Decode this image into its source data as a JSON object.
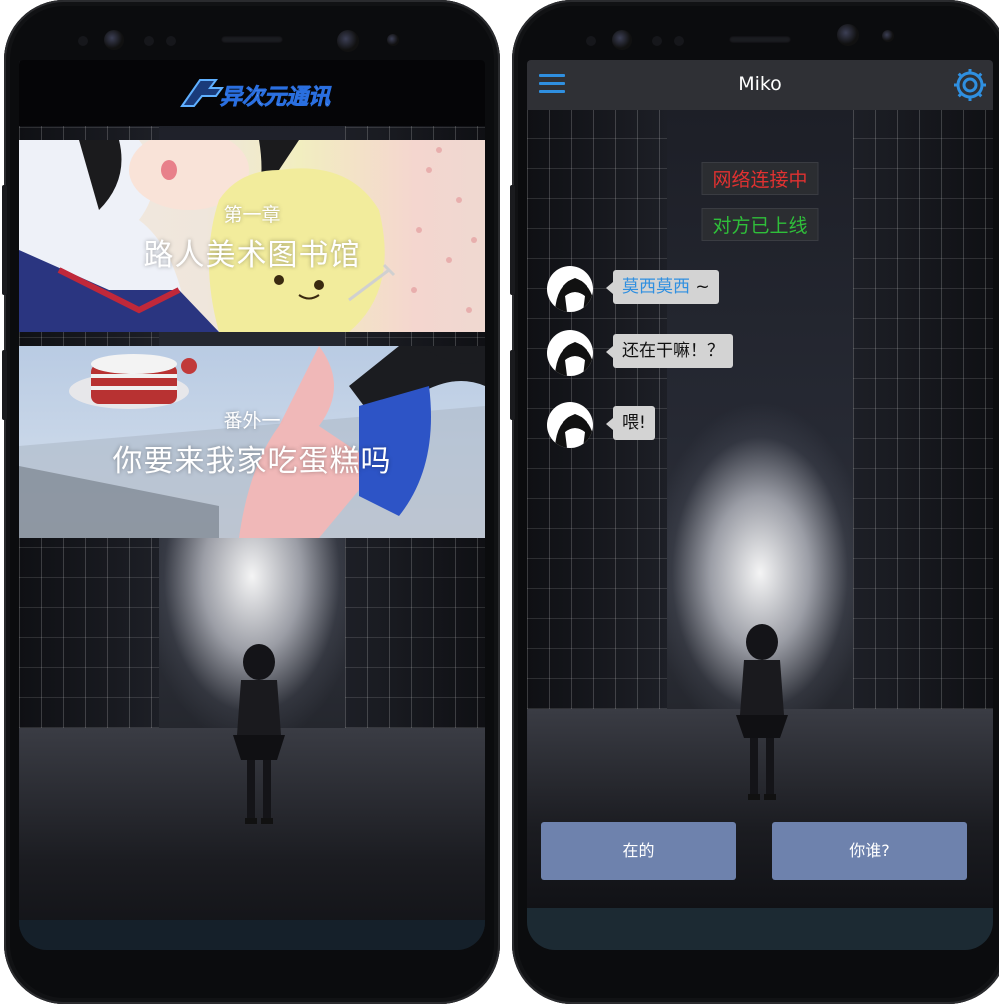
{
  "left_screen": {
    "logo_text": "异次元通讯",
    "stories": [
      {
        "chapter": "第一章",
        "title": "路人美术图书馆"
      },
      {
        "chapter": "番外一",
        "title": "你要来我家吃蛋糕吗"
      }
    ]
  },
  "right_screen": {
    "header": {
      "title": "Miko",
      "menu_icon": "hamburger-menu-icon",
      "settings_icon": "gear-icon"
    },
    "system_messages": [
      {
        "text": "网络连接中",
        "color": "#e03131"
      },
      {
        "text": "对方已上线",
        "color": "#2fbf3a"
      }
    ],
    "messages": [
      {
        "name_part": "莫西莫西",
        "rest": " ~"
      },
      {
        "text": "还在干嘛！？"
      },
      {
        "text": "喂!"
      }
    ],
    "choices": [
      "在的",
      "你谁?"
    ]
  },
  "colors": {
    "accent_blue": "#2f8fe0",
    "choice_button": "#6e82ad",
    "appbar": "#2f3035"
  }
}
